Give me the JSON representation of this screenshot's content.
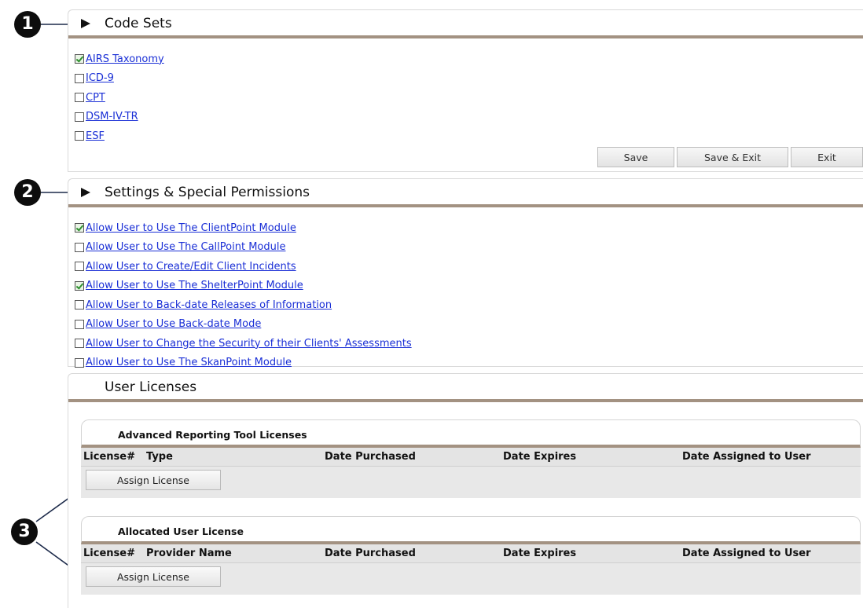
{
  "callouts": [
    "1",
    "2",
    "3"
  ],
  "colors": {
    "accent_rule": "#a39282",
    "link": "#1a2fd6",
    "grid_bg": "#e4e4e4"
  },
  "code_sets": {
    "title": "Code Sets",
    "items": [
      {
        "label": "AIRS Taxonomy",
        "checked": true
      },
      {
        "label": "ICD-9",
        "checked": false
      },
      {
        "label": "CPT",
        "checked": false
      },
      {
        "label": "DSM-IV-TR",
        "checked": false
      },
      {
        "label": "ESF",
        "checked": false
      }
    ],
    "buttons": {
      "save": "Save",
      "save_exit": "Save & Exit",
      "exit": "Exit"
    }
  },
  "settings": {
    "title": "Settings & Special Permissions",
    "items": [
      {
        "label": "Allow User to Use The ClientPoint Module",
        "checked": true
      },
      {
        "label": "Allow User to Use The CallPoint Module",
        "checked": false
      },
      {
        "label": "Allow User to Create/Edit Client Incidents",
        "checked": false
      },
      {
        "label": "Allow User to Use The ShelterPoint Module",
        "checked": true
      },
      {
        "label": "Allow User to Back-date Releases of Information",
        "checked": false
      },
      {
        "label": "Allow User to Use Back-date Mode",
        "checked": false
      },
      {
        "label": "Allow User to Change the Security of their Clients' Assessments",
        "checked": false
      },
      {
        "label": "Allow User to Use The SkanPoint Module",
        "checked": false
      }
    ]
  },
  "user_licenses": {
    "title": "User Licenses",
    "advanced": {
      "title": "Advanced Reporting Tool Licenses",
      "columns": [
        "License#",
        "Type",
        "Date Purchased",
        "Date Expires",
        "Date Assigned to User"
      ],
      "assign_label": "Assign License"
    },
    "allocated": {
      "title": "Allocated User License",
      "columns": [
        "License#",
        "Provider Name",
        "Date Purchased",
        "Date Expires",
        "Date Assigned to User"
      ],
      "assign_label": "Assign License"
    }
  }
}
